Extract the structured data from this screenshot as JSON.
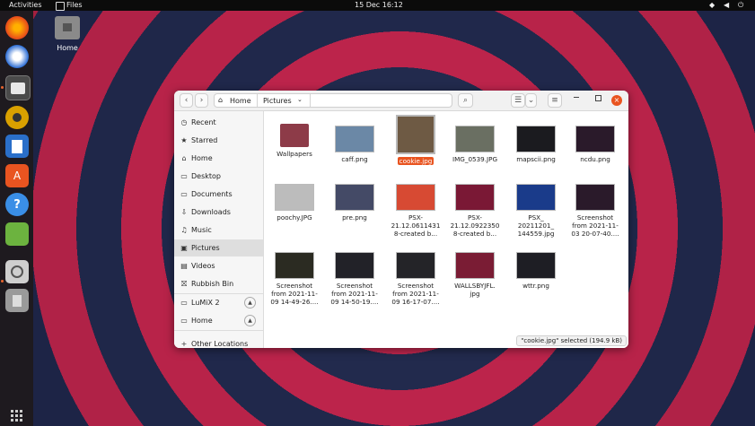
{
  "topbar": {
    "activities": "Activities",
    "app": "Files",
    "clock": "15 Dec  16:12"
  },
  "desktop": {
    "home_label": "Home"
  },
  "dock": [
    "firefox-icon",
    "thunderbird-icon",
    "files-icon",
    "rhythmbox-icon",
    "writer-icon",
    "software-icon",
    "help-icon",
    "extensions-icon",
    "screenshot-icon",
    "trash-icon"
  ],
  "window": {
    "path": [
      "Home",
      "Pictures"
    ],
    "sidebar": [
      {
        "label": "Recent",
        "icon": "clock-icon"
      },
      {
        "label": "Starred",
        "icon": "star-icon"
      },
      {
        "label": "Home",
        "icon": "home-icon"
      },
      {
        "label": "Desktop",
        "icon": "folder-icon"
      },
      {
        "label": "Documents",
        "icon": "folder-icon"
      },
      {
        "label": "Downloads",
        "icon": "download-icon"
      },
      {
        "label": "Music",
        "icon": "music-icon"
      },
      {
        "label": "Pictures",
        "icon": "picture-icon"
      },
      {
        "label": "Videos",
        "icon": "video-icon"
      },
      {
        "label": "Rubbish Bin",
        "icon": "trash-icon"
      },
      {
        "label": "LuMiX 2",
        "icon": "drive-icon"
      },
      {
        "label": "Home",
        "icon": "drive-icon"
      },
      {
        "label": "Other Locations",
        "icon": "plus-icon"
      }
    ],
    "files": [
      {
        "name": "Wallpapers",
        "thumb": "folder"
      },
      {
        "name": "caff.png",
        "thumb": "#6b88a6"
      },
      {
        "name": "cookie.jpg",
        "thumb": "#6e5a44",
        "selected": true
      },
      {
        "name": "IMG_0539.JPG",
        "thumb": "#6a6f62"
      },
      {
        "name": "mapscii.png",
        "thumb": "#1b1b1f"
      },
      {
        "name": "ncdu.png",
        "thumb": "#2a1a2a"
      },
      {
        "name": "poochy.JPG",
        "thumb": "#bcbcbc"
      },
      {
        "name": "pre.png",
        "thumb": "#444a66"
      },
      {
        "name": "PSX-\n21.12.0611431\n8-created b...",
        "thumb": "#d74a33"
      },
      {
        "name": "PSX-\n21.12.0922350\n8-created b...",
        "thumb": "#7a1835"
      },
      {
        "name": "PSX_\n20211201_\n144559.jpg",
        "thumb": "#1a3b8a"
      },
      {
        "name": "Screenshot\nfrom 2021-11-\n03 20-07-40....",
        "thumb": "#2a1a2a"
      },
      {
        "name": "Screenshot\nfrom 2021-11-\n09 14-49-26....",
        "thumb": "#2b2b22"
      },
      {
        "name": "Screenshot\nfrom 2021-11-\n09 14-50-19....",
        "thumb": "#222228"
      },
      {
        "name": "Screenshot\nfrom 2021-11-\n09 16-17-07....",
        "thumb": "#242428"
      },
      {
        "name": "WALLSBYJFL.\njpg",
        "thumb": "#7a1c34"
      },
      {
        "name": "wttr.png",
        "thumb": "#1e1e24"
      }
    ],
    "status": "\"cookie.jpg\" selected (194.9 kB)"
  }
}
